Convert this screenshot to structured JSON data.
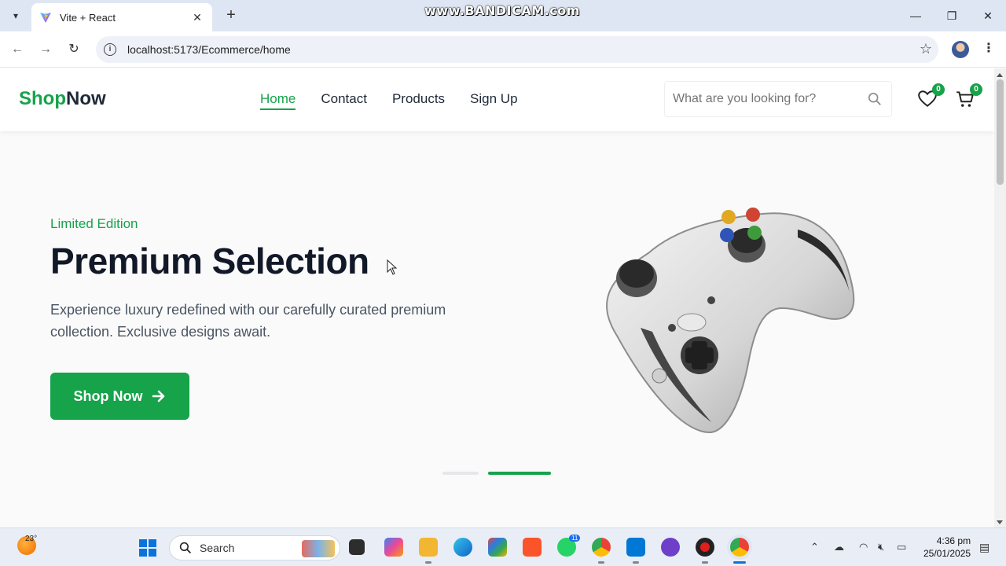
{
  "browser": {
    "tab_title": "Vite + React",
    "url": "localhost:5173/Ecommerce/home",
    "watermark": "www.BANDICAM.com"
  },
  "site": {
    "logo_part1": "Shop",
    "logo_part2": "Now",
    "nav": [
      {
        "label": "Home",
        "active": true
      },
      {
        "label": "Contact",
        "active": false
      },
      {
        "label": "Products",
        "active": false
      },
      {
        "label": "Sign Up",
        "active": false
      }
    ],
    "search_placeholder": "What are you looking for?",
    "wishlist_count": "0",
    "cart_count": "0"
  },
  "hero": {
    "tag": "Limited Edition",
    "title": "Premium Selection",
    "description": "Experience luxury redefined with our carefully curated premium collection. Exclusive designs await.",
    "cta_label": "Shop Now",
    "slide_count": 2,
    "active_slide": 2,
    "image_icon": "game-controller"
  },
  "taskbar": {
    "temperature": "23°",
    "search_label": "Search",
    "time": "4:36 pm",
    "date": "25/01/2025",
    "notification_badge": "11"
  },
  "colors": {
    "brand": "#16a34a",
    "text_dark": "#111827",
    "browser_frame": "#dfe6f3"
  }
}
